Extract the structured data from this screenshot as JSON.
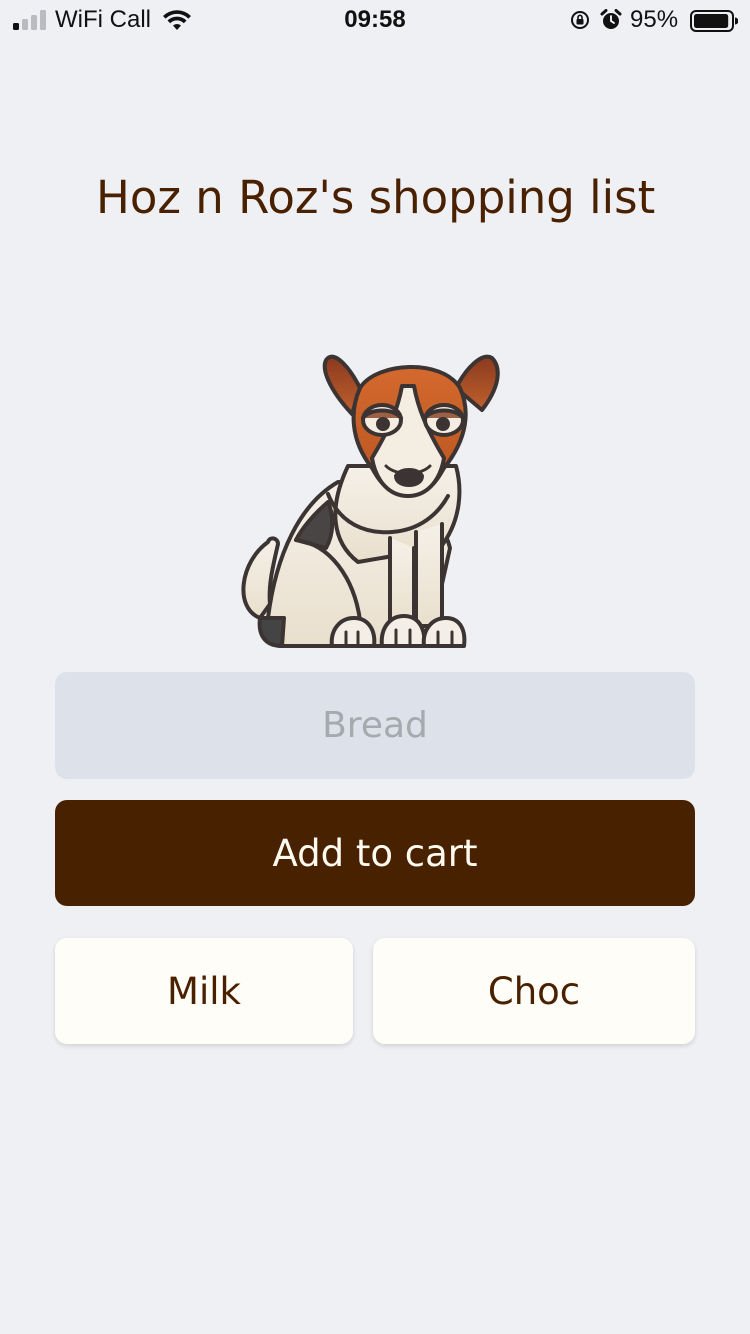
{
  "status_bar": {
    "carrier": "WiFi Call",
    "time": "09:58",
    "battery_percent": "95%",
    "signal_bars_active": 1,
    "signal_bars_total": 4,
    "battery_level": 0.95
  },
  "page": {
    "title": "Hoz n Roz's shopping list"
  },
  "item_input": {
    "value": "",
    "placeholder": "Bread"
  },
  "add_button": {
    "label": "Add to cart"
  },
  "cart_items": [
    {
      "label": "Milk"
    },
    {
      "label": "Choc"
    }
  ],
  "colors": {
    "background": "#eef0f4",
    "title_text": "#4a2100",
    "primary_button": "#482100",
    "primary_button_text": "#fffaf0",
    "input_background": "#dde1ea",
    "chip_background": "#fffdf8",
    "dog_brown": "#c8622a",
    "dog_body": "#f2ebdf"
  },
  "icons": {
    "signal": "cellular-signal-icon",
    "wifi": "wifi-icon",
    "orientation_lock": "orientation-lock-icon",
    "alarm": "alarm-clock-icon",
    "battery": "battery-icon",
    "illustration": "dog-illustration"
  }
}
